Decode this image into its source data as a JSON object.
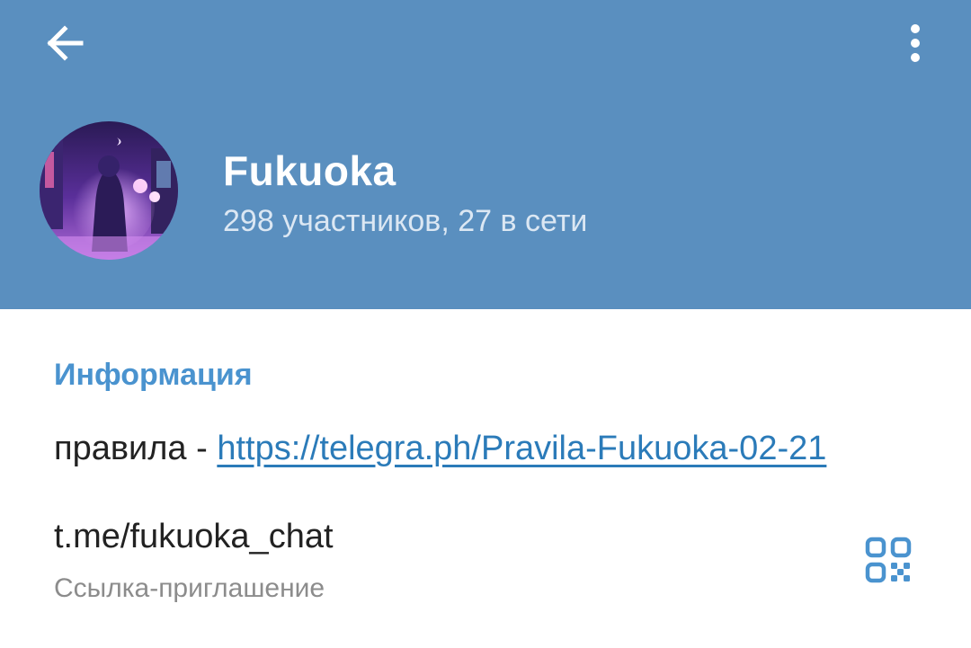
{
  "header": {
    "title": "Fukuoka",
    "subtitle": "298 участников, 27 в сети",
    "back_icon": "arrow-left-icon",
    "menu_icon": "more-vertical-icon",
    "background_color": "#5a8fbf"
  },
  "info": {
    "section_title": "Информация",
    "description_prefix": "правила - ",
    "description_link": "https://telegra.ph/Pravila-Fukuoka-02-21",
    "invite_link": "t.me/fukuoka_chat",
    "invite_caption": "Ссылка-приглашение",
    "qr_icon": "qr-code-icon",
    "accent_color": "#4a93cf",
    "link_color": "#2b7bb9"
  }
}
